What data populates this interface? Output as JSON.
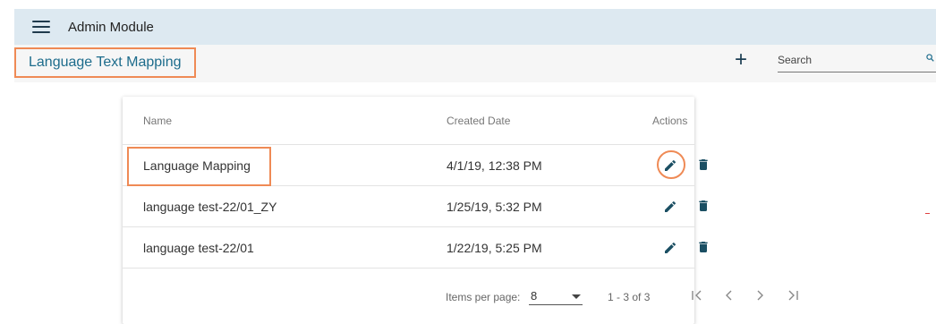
{
  "app": {
    "title": "Admin Module"
  },
  "page": {
    "title": "Language Text Mapping"
  },
  "toolbar": {
    "add_icon": "plus-icon",
    "search_placeholder": "Search",
    "search_icon": "search-icon"
  },
  "table": {
    "columns": [
      "Name",
      "Created Date",
      "Actions"
    ],
    "rows": [
      {
        "name": "Language Mapping",
        "created": "4/1/19, 12:38 PM"
      },
      {
        "name": "language test-22/01_ZY",
        "created": "1/25/19, 5:32 PM"
      },
      {
        "name": "language test-22/01",
        "created": "1/22/19, 5:25 PM"
      }
    ],
    "row_action_icons": [
      "pencil-icon",
      "trash-icon"
    ]
  },
  "paginator": {
    "items_label": "Items per page:",
    "page_size": "8",
    "range": "1 - 3 of 3",
    "nav_icons": [
      "first-page-icon",
      "prev-page-icon",
      "next-page-icon",
      "last-page-icon"
    ]
  },
  "colors": {
    "accent": "#1d6c8c",
    "icon": "#1b4f63",
    "highlight": "#ef8a55",
    "topbar_bg": "#dde9f1"
  }
}
